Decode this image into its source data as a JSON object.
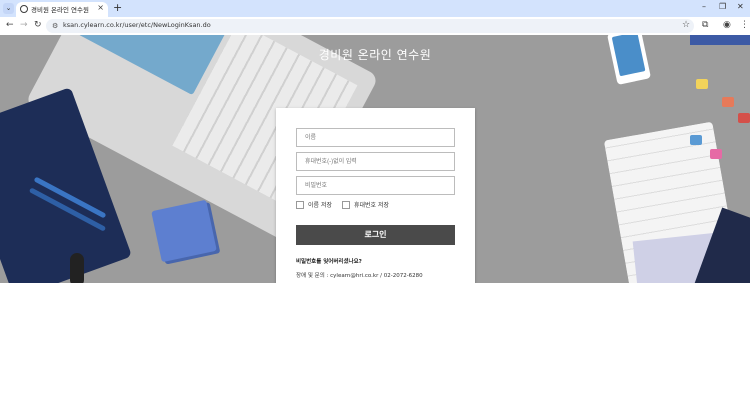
{
  "browser": {
    "tab_title": "경비원 온라인 연수원",
    "new_tab_glyph": "+",
    "url": "ksan.cylearn.co.kr/user/etc/NewLoginKsan.do"
  },
  "page": {
    "title": "경비원 온라인 연수원"
  },
  "login": {
    "name_placeholder": "이름",
    "phone_placeholder": "휴대번호(-)없이 입력",
    "password_placeholder": "비밀번호",
    "save_name_label": "이름 저장",
    "save_phone_label": "휴대번호 저장",
    "login_button": "로그인",
    "forgot_password": "비밀번호를 잊어버리셨나요?",
    "contact": "장애 및 문의 : cylearn@hri.co.kr / 02-2072-6280"
  },
  "colors": {
    "tabstrip": "#d3e3fd",
    "hero_bg": "#9c9c9c",
    "button": "#4a4a4a"
  }
}
